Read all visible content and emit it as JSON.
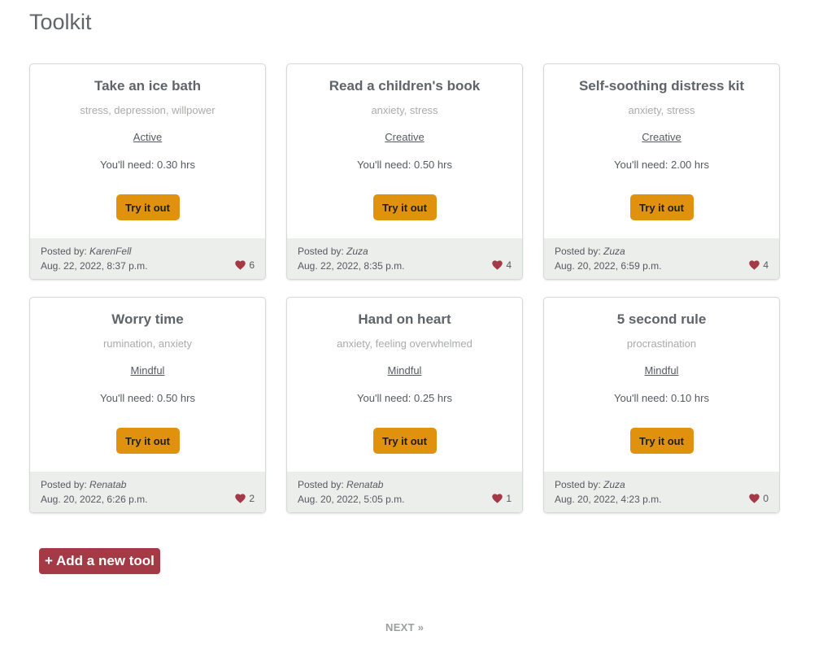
{
  "page": {
    "title": "Toolkit"
  },
  "labels": {
    "posted_by": "Posted by: ",
    "you_need_prefix": "You'll need: ",
    "try_button": "Try it out"
  },
  "tools": [
    {
      "title": "Take an ice bath",
      "tags": "stress, depression, willpower",
      "category": "Active",
      "time": "0.30 hrs",
      "author": "KarenFell",
      "date": "Aug. 22, 2022, 8:37 p.m.",
      "likes": "6"
    },
    {
      "title": "Read a children's book",
      "tags": "anxiety, stress",
      "category": "Creative",
      "time": "0.50 hrs",
      "author": "Zuza",
      "date": "Aug. 22, 2022, 8:35 p.m.",
      "likes": "4"
    },
    {
      "title": "Self-soothing distress kit",
      "tags": "anxiety, stress",
      "category": "Creative",
      "time": "2.00 hrs",
      "author": "Zuza",
      "date": "Aug. 20, 2022, 6:59 p.m.",
      "likes": "4"
    },
    {
      "title": "Worry time",
      "tags": "rumination, anxiety",
      "category": "Mindful",
      "time": "0.50 hrs",
      "author": "Renatab",
      "date": "Aug. 20, 2022, 6:26 p.m.",
      "likes": "2"
    },
    {
      "title": "Hand on heart",
      "tags": "anxiety, feeling overwhelmed",
      "category": "Mindful",
      "time": "0.25 hrs",
      "author": "Renatab",
      "date": "Aug. 20, 2022, 5:05 p.m.",
      "likes": "1"
    },
    {
      "title": "5 second rule",
      "tags": "procrastination",
      "category": "Mindful",
      "time": "0.10 hrs",
      "author": "Zuza",
      "date": "Aug. 20, 2022, 4:23 p.m.",
      "likes": "0"
    }
  ],
  "actions": {
    "add_tool": "+ Add a new tool"
  },
  "pagination": {
    "next": "NEXT »"
  },
  "icons": {
    "like": "heart-icon"
  },
  "colors": {
    "try_button": "#e0920f",
    "add_button": "#a33a46",
    "heart": "#a33a46",
    "footer_bg": "#eceeec"
  }
}
